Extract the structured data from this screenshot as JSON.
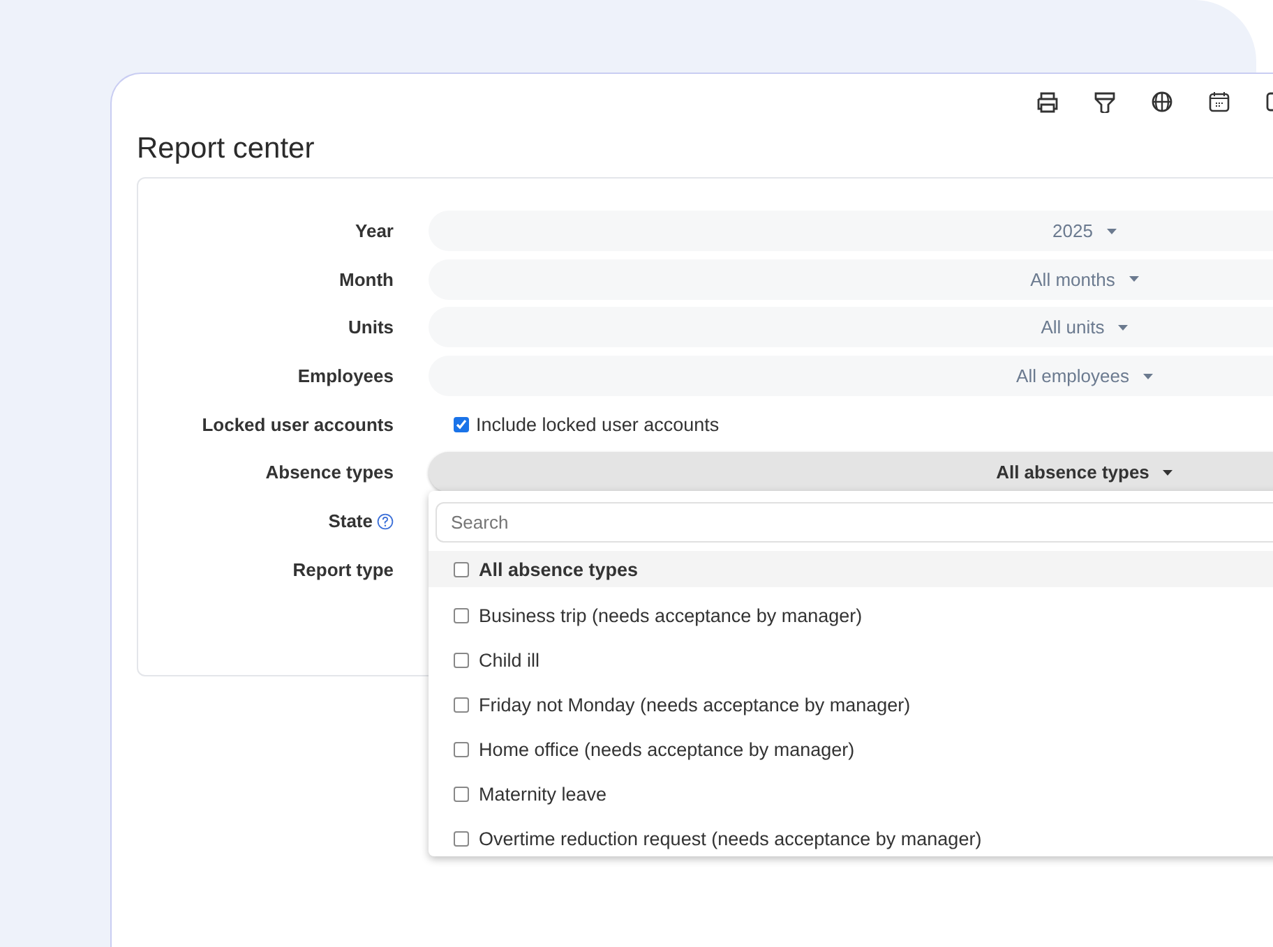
{
  "window": {
    "title": "Report center"
  },
  "form": {
    "rows": [
      {
        "label": "Year",
        "kind": "select",
        "value": "2025",
        "open": false
      },
      {
        "label": "Month",
        "kind": "select",
        "value": "All months",
        "open": false
      },
      {
        "label": "Units",
        "kind": "select",
        "value": "All units",
        "open": false
      },
      {
        "label": "Employees",
        "kind": "select",
        "value": "All employees",
        "open": false
      },
      {
        "label": "Locked user accounts",
        "kind": "checkbox",
        "text": "Include locked user accounts",
        "checked": true
      },
      {
        "label": "Absence types",
        "kind": "select",
        "value": "All absence types",
        "open": true
      },
      {
        "label": "State",
        "kind": "help"
      },
      {
        "label": "Report type",
        "kind": "empty"
      }
    ]
  },
  "dropdown": {
    "search": {
      "placeholder": "Search"
    },
    "options": [
      {
        "label": "All absence types",
        "kind": "all",
        "checked": false
      },
      {
        "label": "Business trip (needs acceptance by manager)",
        "kind": "item",
        "checked": false
      },
      {
        "label": "Child ill",
        "kind": "item",
        "checked": false
      },
      {
        "label": "Friday not Monday (needs acceptance by manager)",
        "kind": "item",
        "checked": false
      },
      {
        "label": "Home office (needs acceptance by manager)",
        "kind": "item",
        "checked": false
      },
      {
        "label": "Maternity leave",
        "kind": "item",
        "checked": false
      },
      {
        "label": "Overtime reduction request (needs acceptance by manager)",
        "kind": "item",
        "checked": false
      }
    ]
  }
}
